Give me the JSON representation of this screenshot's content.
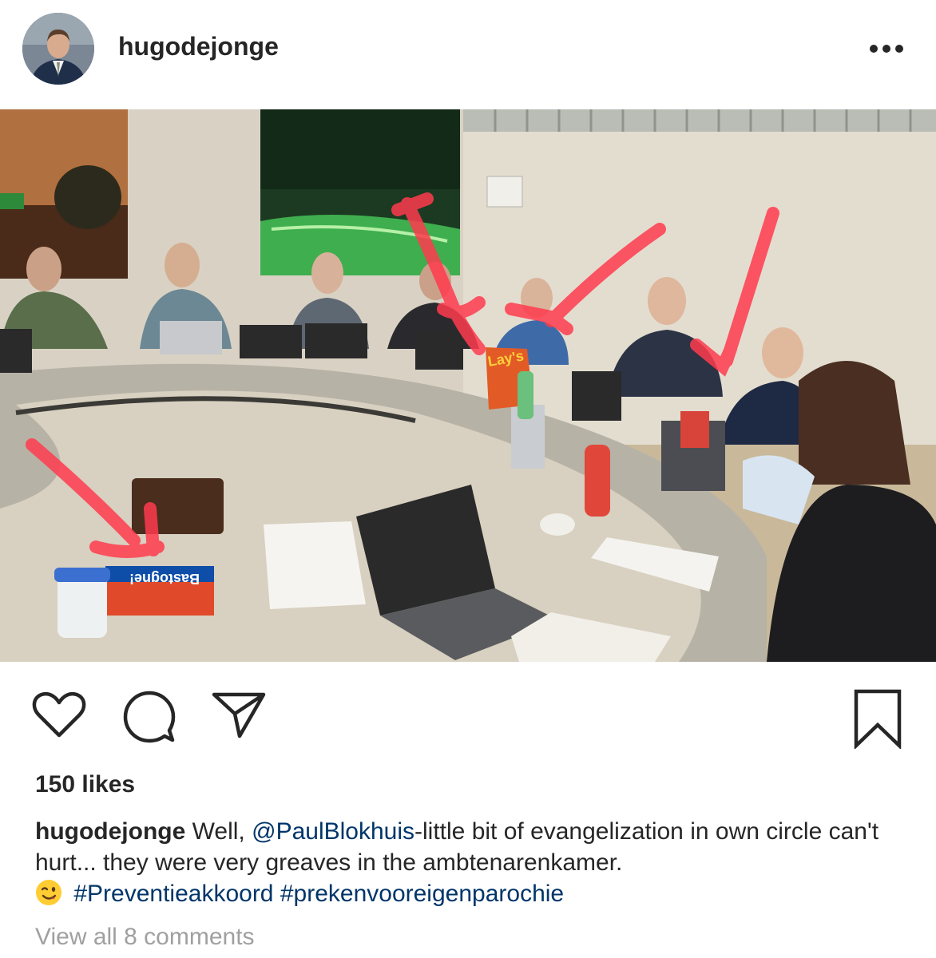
{
  "post": {
    "username": "hugodejonge",
    "more_icon": "more-horizontal-icon",
    "photo_alt": "photo",
    "likes_text": "150 likes",
    "caption": {
      "username": "hugodejonge",
      "text_before_mention": " Well, ",
      "mention": "@PaulBlokhuis",
      "text_after_mention": "-little bit of evangelization in own circle can't hurt... they were very greaves in the ambtenarenkamer.",
      "emoji": "wink-emoji",
      "hashtag_1": "#Preventieakkoord",
      "hashtag_2": "#prekenvooreigenparochie"
    },
    "view_comments": "View all 8 comments"
  },
  "photo_labels": {
    "chips_brand": "Lay's",
    "cookie_brand": "Bastogne!"
  },
  "icons": {
    "like": "heart-icon",
    "comment": "comment-bubble-icon",
    "share": "paper-plane-icon",
    "save": "bookmark-icon"
  },
  "colors": {
    "text": "#262626",
    "link": "#003569",
    "muted": "#a0a0a0",
    "annotation_red": "#ff3b4e"
  }
}
